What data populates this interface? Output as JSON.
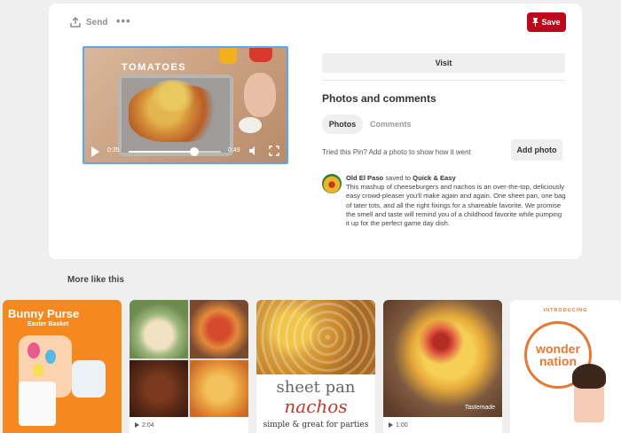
{
  "toolbar": {
    "send_label": "Send",
    "more_label": "•••",
    "save_label": "Save"
  },
  "video": {
    "title": "TOMATOES",
    "current_time": "0:35",
    "total_time": "0:49",
    "progress": 0.71
  },
  "visit_label": "Visit",
  "photos_comments": {
    "title": "Photos and comments",
    "tabs": [
      "Photos",
      "Comments"
    ],
    "tried_text": "Tried this Pin? Add a photo to show how it went",
    "add_photo_label": "Add photo"
  },
  "pin_info": {
    "author": "Old El Paso",
    "saved_to": "saved to",
    "board": "Quick & Easy",
    "description": "This mashup of cheeseburgers and nachos is an over-the-top, deliciously easy crowd-pleaser you'll make again and again. One sheet pan, one bag of tater tots, and all the right fixings for a shareable favorite. We promise the smell and taste will remind you of a childhood favorite while pumping it up for the perfect game day dish."
  },
  "more_like_this": {
    "title": "More like this",
    "pins": [
      {
        "title": "Bunny Purse",
        "subtitle": "Easter Basket"
      },
      {
        "duration": "2:04"
      },
      {
        "line1": "sheet pan",
        "line2": "nachos",
        "line3": "simple & great for parties"
      },
      {
        "duration": "1:00",
        "watermark": "Tastemade"
      },
      {
        "intro": "INTRODUCING",
        "brand": "wonder nation"
      }
    ]
  },
  "colors": {
    "save": "#bd081c",
    "accent_orange": "#e67835",
    "video_border": "#5aa8ef"
  }
}
